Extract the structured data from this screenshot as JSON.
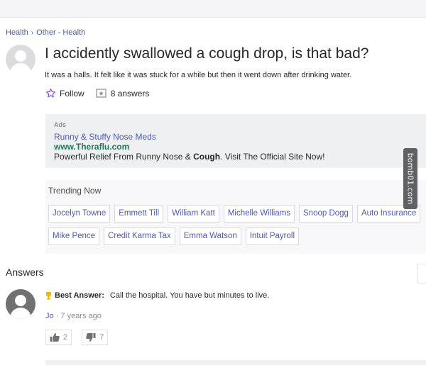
{
  "breadcrumb": {
    "category": "Health",
    "subcategory": "Other - Health",
    "separator": "›"
  },
  "question": {
    "title": "I accidently swallowed a cough drop, is that bad?",
    "details": "It was a halls. It felt like it was stuck for a while but then it went down after drinking water.",
    "follow_label": "Follow",
    "answers_count_label": "8 answers"
  },
  "ads": {
    "label": "Ads",
    "link": "Runny & Stuffy Nose Meds",
    "url": "www.Theraflu.com",
    "text_before": "Powerful Relief From Runny Nose & ",
    "text_bold": "Cough",
    "text_after": ". Visit The Official Site Now!"
  },
  "trending": {
    "title": "Trending Now",
    "row1": [
      "Jocelyn Towne",
      "Emmett Till",
      "William Katt",
      "Michelle Williams",
      "Snoop Dogg",
      "Auto Insurance"
    ],
    "row2": [
      "Mike Pence",
      "Credit Karma Tax",
      "Emma Watson",
      "Intuit Payroll"
    ]
  },
  "answers": {
    "heading": "Answers",
    "best_label": "Best Answer:",
    "best_text": "Call the hospital. You have but minutes to live.",
    "author": "Jo",
    "time": " · 7 years ago",
    "upvotes": "2",
    "downvotes": "7"
  },
  "watermark": "bomb01.com",
  "colors": {
    "link": "#4d5ab3",
    "ad_url": "#1c7a5a",
    "trophy": "#f5b800",
    "follow_star": "#7b3fe4"
  },
  "icons": [
    "chevron-right-icon",
    "star-outline-icon",
    "answers-icon",
    "trophy-icon",
    "thumbs-up-icon",
    "thumbs-down-icon",
    "user-avatar-icon"
  ]
}
